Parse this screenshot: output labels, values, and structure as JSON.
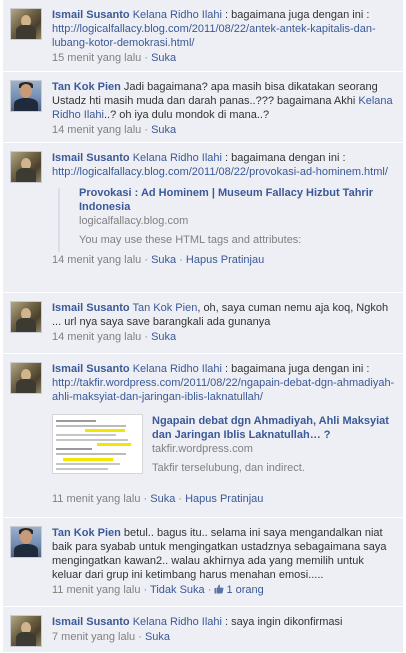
{
  "comments": [
    {
      "author": "Ismail Susanto",
      "mention": "Kelana Ridho Ilahi",
      "text": " : bagaimana juga dengan ini : ",
      "url": "http://logicalfallacy.blog.com/2011/08/22/antek-antek-kapitalis-dan-lubang-kotor-demokrasi.html/",
      "time": "15 menit yang lalu",
      "sep": " · ",
      "like": "Suka"
    },
    {
      "author": "Tan Kok Pien",
      "text_a": " Jadi bagaimana? apa masih bisa dikatakan seorang Ustadz hti masih muda dan darah panas..??? bagaimana Akhi ",
      "mention": "Kelana Ridho Ilahi",
      "text_b": "..? oh iya dulu mondok di mana..?",
      "time": "14 menit yang lalu",
      "sep": " · ",
      "like": "Suka"
    },
    {
      "author": "Ismail Susanto",
      "mention": "Kelana Ridho Ilahi",
      "text": " : bagaimana dengan ini : ",
      "url": "http://logicalfallacy.blog.com/2011/08/22/provokasi-ad-hominem.html/",
      "attach_title": "Provokasi : Ad Hominem | Museum Fallacy Hizbut Tahrir Indonesia",
      "attach_domain": "logicalfallacy.blog.com",
      "attach_desc": "You may use these HTML tags and attributes:",
      "time": "14 menit yang lalu",
      "sep": " · ",
      "like": "Suka",
      "remove": "Hapus Pratinjau"
    },
    {
      "author": "Ismail Susanto",
      "mention": "Tan Kok Pien",
      "text": ", oh, saya cuman nemu aja koq, Ngkoh ... url nya saya save barangkali ada gunanya",
      "time": "14 menit yang lalu",
      "sep": " · ",
      "like": "Suka"
    },
    {
      "author": "Ismail Susanto",
      "mention": "Kelana Ridho Ilahi",
      "text": " : bagaimana juga dengan ini : ",
      "url": "http://takfir.wordpress.com/2011/08/22/ngapain-debat-dgn-ahmadiyah-ahli-maksyiat-dan-jaringan-iblis-laknatullah/",
      "attach_title": "Ngapain debat dgn Ahmadiyah, Ahli Maksyiat dan Jaringan Iblis Laknatullah… ?",
      "attach_domain": "takfir.wordpress.com",
      "attach_desc": "Takfir terselubung, dan indirect.",
      "time": "11 menit yang lalu",
      "sep": " · ",
      "like": "Suka",
      "remove": "Hapus Pratinjau"
    },
    {
      "author": "Tan Kok Pien",
      "text": " betul.. bagus itu.. selama ini saya mengandalkan niat baik para syabab untuk mengingatkan ustadznya sebagaimana saya mengingatkan kawan2.. walau akhirnya ada yang memilih untuk keluar dari grup ini ketimbang harus menahan emosi.....",
      "time": "11 menit yang lalu",
      "sep": " · ",
      "unlike": "Tidak Suka",
      "likes": "1 orang"
    },
    {
      "author": "Ismail Susanto",
      "mention": "Kelana Ridho Ilahi",
      "text": " : saya ingin dikonfirmasi",
      "time": "7 menit yang lalu",
      "sep": " · ",
      "like": "Suka"
    }
  ],
  "colors": {
    "link": "#3b5998",
    "bg": "#edeff4",
    "meta": "#808080",
    "highlight": "#f3e600"
  },
  "icons": {
    "like": "thumbs-up-icon"
  }
}
